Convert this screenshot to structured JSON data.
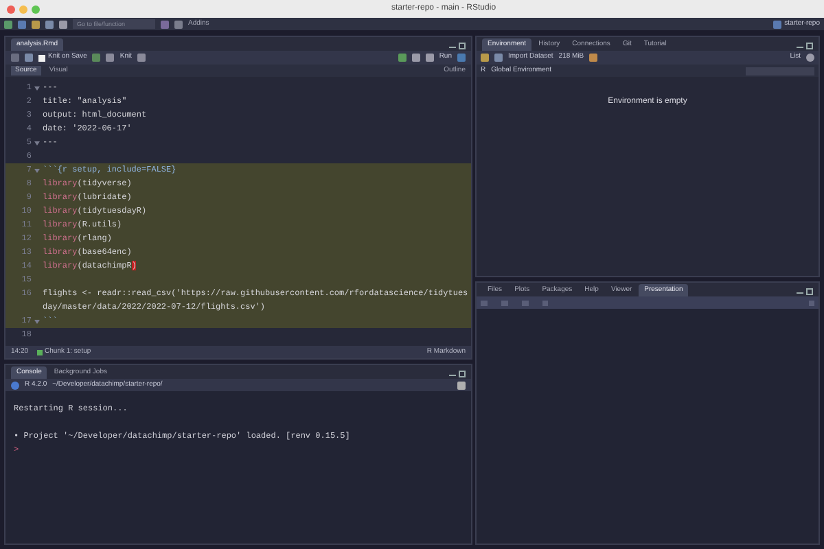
{
  "window": {
    "title": "starter-repo - main - RStudio"
  },
  "main_toolbar": {
    "search": {
      "placeholder": "Go to file/function"
    },
    "addins": "Addins",
    "project": "starter-repo"
  },
  "editor": {
    "tabs": [
      {
        "label": "analysis.Rmd",
        "selected": true
      }
    ],
    "toolbar": {
      "knit_on_save": {
        "label": "Knit on Save",
        "checked": false
      },
      "knit": "Knit",
      "run": "Run"
    },
    "modes": [
      {
        "label": "Source",
        "selected": true
      },
      {
        "label": "Visual",
        "selected": false
      }
    ],
    "outline": "Outline",
    "lines": [
      {
        "number": "1",
        "fold": true,
        "chunk": false,
        "segments": [
          {
            "kind": "plain",
            "text": "---"
          }
        ]
      },
      {
        "number": "2",
        "fold": false,
        "chunk": false,
        "segments": [
          {
            "kind": "plain",
            "text": "title: \"analysis\""
          }
        ]
      },
      {
        "number": "3",
        "fold": false,
        "chunk": false,
        "segments": [
          {
            "kind": "plain",
            "text": "output: html_document"
          }
        ]
      },
      {
        "number": "4",
        "fold": false,
        "chunk": false,
        "segments": [
          {
            "kind": "plain",
            "text": "date: '2022-06-17'"
          }
        ]
      },
      {
        "number": "5",
        "fold": true,
        "chunk": false,
        "segments": [
          {
            "kind": "plain",
            "text": "---"
          }
        ]
      },
      {
        "number": "6",
        "fold": false,
        "chunk": false
      },
      {
        "number": "7",
        "fold": true,
        "chunk": true,
        "segments": [
          {
            "kind": "header",
            "text": "```{r setup, include=FALSE}"
          }
        ]
      },
      {
        "number": "8",
        "fold": false,
        "chunk": true,
        "segments": [
          {
            "kind": "fn",
            "text": "library"
          },
          {
            "kind": "plain",
            "text": "(tidyverse)"
          }
        ]
      },
      {
        "number": "9",
        "fold": false,
        "chunk": true,
        "segments": [
          {
            "kind": "fn",
            "text": "library"
          },
          {
            "kind": "plain",
            "text": "(lubridate)"
          }
        ]
      },
      {
        "number": "10",
        "fold": false,
        "chunk": true,
        "segments": [
          {
            "kind": "fn",
            "text": "library"
          },
          {
            "kind": "plain",
            "text": "(tidytuesdayR)"
          }
        ]
      },
      {
        "number": "11",
        "fold": false,
        "chunk": true,
        "segments": [
          {
            "kind": "fn",
            "text": "library"
          },
          {
            "kind": "plain",
            "text": "(R.utils)"
          }
        ]
      },
      {
        "number": "12",
        "fold": false,
        "chunk": true,
        "segments": [
          {
            "kind": "fn",
            "text": "library"
          },
          {
            "kind": "plain",
            "text": "(rlang)"
          }
        ]
      },
      {
        "number": "13",
        "fold": false,
        "chunk": true,
        "segments": [
          {
            "kind": "fn",
            "text": "library"
          },
          {
            "kind": "plain",
            "text": "(base64enc)"
          }
        ]
      },
      {
        "number": "14",
        "fold": false,
        "chunk": true,
        "segments": [
          {
            "kind": "fn",
            "text": "library"
          },
          {
            "kind": "plain",
            "text": "(datachimpR"
          },
          {
            "kind": "match",
            "text": ")"
          }
        ]
      },
      {
        "number": "15",
        "fold": false,
        "chunk": true
      },
      {
        "number": "16",
        "fold": false,
        "chunk": true,
        "segments": [
          {
            "kind": "plain",
            "text": "flights <- readr::read_csv('https://raw.githubusercontent.com/rfordatascience/tidytuesday/master/data/2022/2022-07-12/flights.csv')"
          }
        ]
      },
      {
        "number": "17",
        "fold": true,
        "chunk": true,
        "segments": [
          {
            "kind": "header",
            "text": "```"
          }
        ]
      },
      {
        "number": "18",
        "fold": false,
        "chunk": false
      }
    ],
    "status": {
      "position": "14:20",
      "chunk": "Chunk 1: setup",
      "language": "R Markdown"
    }
  },
  "console": {
    "tabs": [
      {
        "label": "Console",
        "selected": true
      },
      {
        "label": "Background Jobs",
        "selected": false
      }
    ],
    "version": "R 4.2.0",
    "path": "~/Developer/datachimp/starter-repo/",
    "lines": [
      {
        "text": "Restarting R session...",
        "spaced": false
      },
      {
        "text": "• Project '~/Developer/datachimp/starter-repo' loaded. [renv 0.15.5]",
        "spaced": true
      }
    ],
    "prompt": ">"
  },
  "environment": {
    "tabs": [
      {
        "label": "Environment",
        "selected": true
      },
      {
        "label": "History",
        "selected": false
      },
      {
        "label": "Connections",
        "selected": false
      },
      {
        "label": "Git",
        "selected": false
      },
      {
        "label": "Tutorial",
        "selected": false
      }
    ],
    "import": "Import Dataset",
    "memory": "218 MiB",
    "view": "List",
    "language": "R",
    "scope": "Global Environment",
    "empty": "Environment is empty"
  },
  "files": {
    "tabs": [
      {
        "label": "Files",
        "selected": false
      },
      {
        "label": "Plots",
        "selected": false
      },
      {
        "label": "Packages",
        "selected": false
      },
      {
        "label": "Help",
        "selected": false
      },
      {
        "label": "Viewer",
        "selected": false
      },
      {
        "label": "Presentation",
        "selected": true
      }
    ]
  }
}
